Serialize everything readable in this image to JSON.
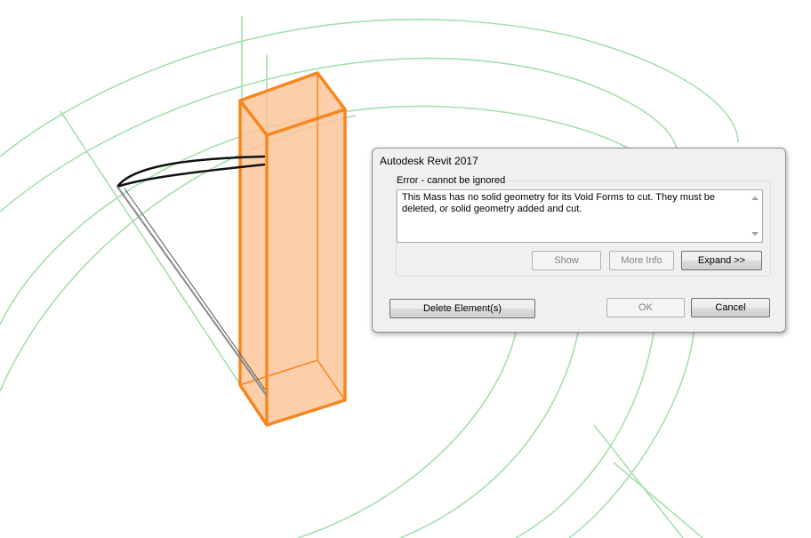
{
  "dialog": {
    "title": "Autodesk Revit 2017",
    "group_label": "Error - cannot be ignored",
    "message": "This Mass has no solid geometry for its Void Forms to cut. They must be deleted, or solid geometry added and cut.",
    "buttons": {
      "show": "Show",
      "more_info": "More Info",
      "expand": "Expand >>",
      "delete": "Delete Element(s)",
      "ok": "OK",
      "cancel": "Cancel"
    }
  },
  "colors": {
    "guide_lines": "#a6dfae",
    "mass_outline": "#f7861f",
    "mass_fill": "#fbc69a"
  }
}
